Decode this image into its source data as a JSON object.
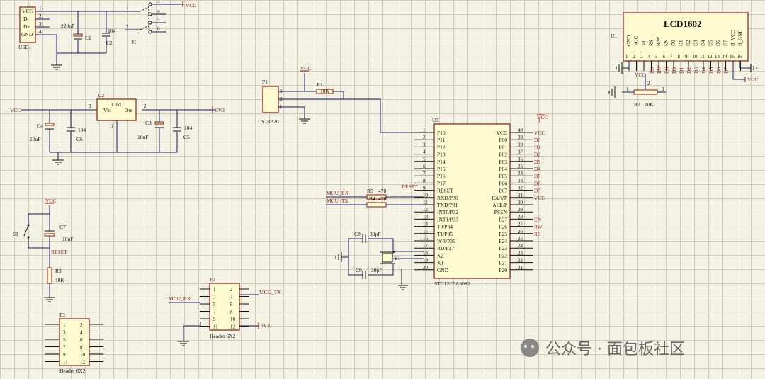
{
  "usb1": {
    "designator": "USB1",
    "pins": [
      "VCC",
      "D-",
      "D+",
      "GND"
    ],
    "pin_nums": [
      "1",
      "2",
      "3",
      "4"
    ]
  },
  "c1": {
    "designator": "C1",
    "value": "220uF"
  },
  "c2": {
    "designator": "C2",
    "value": "104"
  },
  "j1": {
    "designator": "J1",
    "pins": [
      "1",
      "2",
      "3",
      "4",
      "5",
      "6"
    ]
  },
  "vcc": "VCC",
  "v33": "3V3",
  "u2": {
    "designator": "U2",
    "vin": "Vin",
    "gnd": "Gnd",
    "out": "Out",
    "pin1": "1",
    "pin2": "2",
    "pin3": "3"
  },
  "c4": {
    "designator": "C4",
    "value": "10uF"
  },
  "c6": {
    "designator": "C6",
    "value": "104"
  },
  "c3": {
    "designator": "C3",
    "value": "10uF"
  },
  "c5": {
    "designator": "C5",
    "value": "104"
  },
  "p1": {
    "designator": "P1",
    "part": "DS18B20",
    "pins": [
      "3",
      "2",
      "1"
    ]
  },
  "r1": {
    "designator": "R1",
    "value": "10K"
  },
  "s1": {
    "designator": "S1"
  },
  "c7": {
    "designator": "C7",
    "value": "10uF"
  },
  "reset_net": "RESET",
  "r3": {
    "designator": "R3",
    "value": "10K"
  },
  "lcd": {
    "title": "LCD1602",
    "designator": "U1",
    "pins": [
      "GND",
      "VCC",
      "VL",
      "RS",
      "R/W",
      "EN",
      "D0",
      "D1",
      "D2",
      "D3",
      "D4",
      "D5",
      "D6",
      "D7",
      "B_VCC",
      "B_GND"
    ],
    "pin_nums": [
      "1",
      "2",
      "3",
      "4",
      "5",
      "6",
      "7",
      "8",
      "9",
      "10",
      "11",
      "12",
      "13",
      "14",
      "15",
      "16"
    ],
    "nets": [
      "RS",
      "RW",
      "EN",
      "D0",
      "D1",
      "D2",
      "D3",
      "D4",
      "D5",
      "D6",
      "D7"
    ]
  },
  "r2": {
    "designator": "R2",
    "value": "10K",
    "pins": [
      "1",
      "2",
      "3"
    ]
  },
  "u3": {
    "designator": "U3",
    "part": "STC12C5A60S2",
    "left_pins": [
      "P10",
      "P11",
      "P12",
      "P13",
      "P14",
      "P15",
      "P16",
      "P17",
      "RESET",
      "RXD/P30",
      "TXD/P31",
      "INT0/P32",
      "INT1/P33",
      "T0/P34",
      "T1/P35",
      "WR/P36",
      "RD/P37",
      "X2",
      "X1",
      "GND"
    ],
    "left_nums": [
      "1",
      "2",
      "3",
      "4",
      "5",
      "6",
      "7",
      "8",
      "9",
      "10",
      "11",
      "12",
      "13",
      "14",
      "15",
      "16",
      "17",
      "18",
      "19",
      "20"
    ],
    "right_pins": [
      "VCC",
      "P00",
      "P01",
      "P02",
      "P03",
      "P04",
      "P05",
      "P06",
      "P07",
      "EA/VP",
      "ALE/P",
      "PSEN",
      "P27",
      "P26",
      "P25",
      "P24",
      "P23",
      "P22",
      "P21",
      "P20"
    ],
    "right_nums": [
      "40",
      "39",
      "38",
      "37",
      "36",
      "35",
      "34",
      "33",
      "32",
      "31",
      "30",
      "29",
      "28",
      "27",
      "26",
      "25",
      "24",
      "23",
      "22",
      "21"
    ],
    "right_nets": [
      "VCC",
      "D0",
      "D1",
      "D2",
      "D3",
      "D4",
      "D5",
      "D6",
      "D7",
      "VCC",
      "",
      "",
      "EN",
      "RW",
      "RS",
      "",
      "",
      "",
      "",
      ""
    ]
  },
  "mcu_rx": "MCU_RX",
  "mcu_tx": "MCU_TX",
  "r5": {
    "designator": "R5",
    "value": "470"
  },
  "r4": {
    "designator": "R4",
    "value": "470"
  },
  "c8": {
    "designator": "C8",
    "value": "30pF"
  },
  "c9": {
    "designator": "C9",
    "value": "30pF"
  },
  "y1": {
    "designator": "Y1"
  },
  "p2": {
    "designator": "P2",
    "part": "Header 6X2",
    "left": [
      "1",
      "3",
      "5",
      "7",
      "9",
      "11"
    ],
    "right": [
      "2",
      "4",
      "6",
      "8",
      "10",
      "12"
    ]
  },
  "p3": {
    "designator": "P3",
    "part": "Header 6X2",
    "left": [
      "1",
      "3",
      "5",
      "7",
      "9",
      "11"
    ],
    "right": [
      "2",
      "4",
      "6",
      "8",
      "10",
      "12"
    ]
  },
  "watermark": "公众号 · 面包板社区",
  "colors": {
    "wire": "#1a1a66",
    "body_stroke": "#8b1a1a",
    "body_fill": "#fffbd0",
    "net": "#8b1a1a",
    "grid": "#cfcab3",
    "background": "#f4f2e4"
  }
}
